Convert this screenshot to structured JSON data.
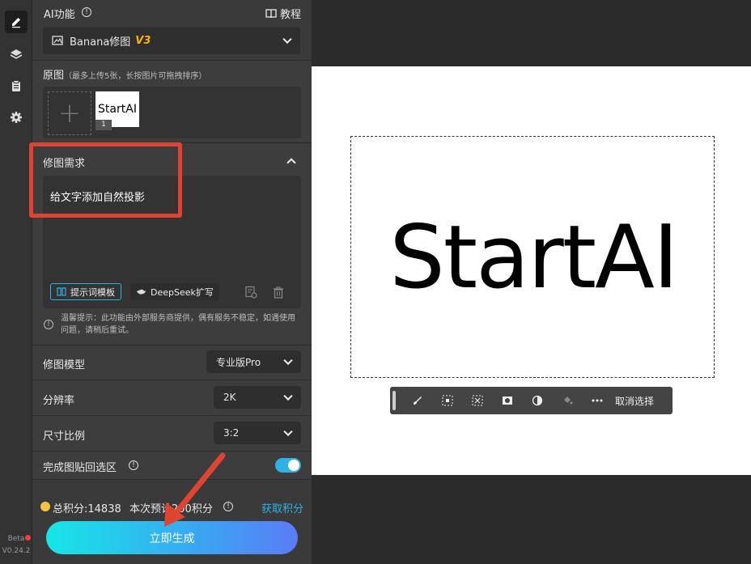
{
  "rail": {
    "version_tag": "Beta",
    "version": "V0.24.2"
  },
  "header": {
    "title": "AI功能",
    "tutorial_label": "教程"
  },
  "model_select": {
    "name": "Banana修图",
    "version_badge": "V3"
  },
  "original": {
    "title": "原图",
    "hint": "（最多上传5张，长按图片可拖拽排序）",
    "thumb_text": "StartAI",
    "thumb_index": "1"
  },
  "requirement": {
    "title": "修图需求",
    "text": "给文字添加自然投影",
    "template_button": "提示词模板",
    "deepseek_button": "DeepSeek扩写"
  },
  "notice": "温馨提示：此功能由外部服务商提供，偶有服务不稳定，如遇使用问题，请稍后重试。",
  "settings": {
    "model_label": "修图模型",
    "model_value": "专业版Pro",
    "resolution_label": "分辨率",
    "resolution_value": "2K",
    "ratio_label": "尺寸比例",
    "ratio_value": "3:2",
    "paste_label": "完成图贴回选区",
    "paste_enabled": true
  },
  "points": {
    "total": "总积分:14838",
    "estimate": "本次预计200积分",
    "get_points": "获取积分"
  },
  "generate_button": "立即生成",
  "canvas": {
    "text": "StartAI",
    "cancel_selection": "取消选择"
  },
  "colors": {
    "accent": "#2fb1e6",
    "highlight": "#e0432f",
    "gradient_start": "#17e6e6",
    "gradient_end": "#5a7cf6"
  }
}
